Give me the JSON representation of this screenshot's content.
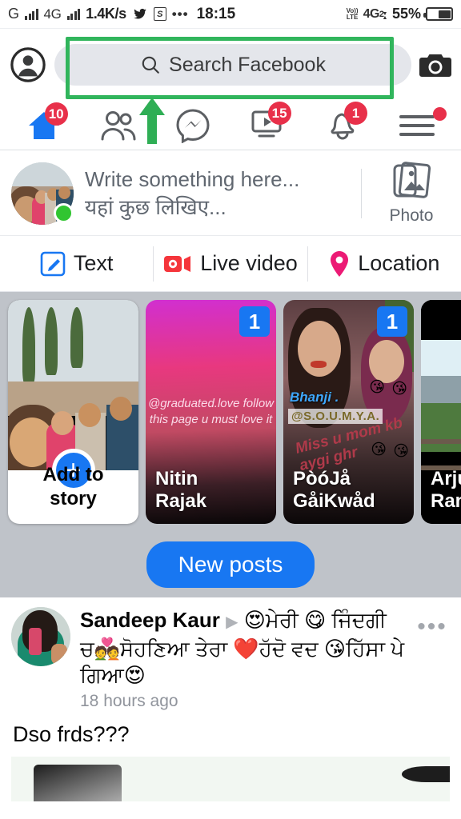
{
  "status_bar": {
    "network_letter": "G",
    "network_type": "4G",
    "data_speed": "1.4K/s",
    "app_icons": [
      "twitter-icon",
      "s-app-icon",
      "more-dots-icon"
    ],
    "time": "18:15",
    "volte_label_top": "Vo))",
    "volte_label_bottom": "LTE",
    "sim_label": "4G",
    "sim_number": "2",
    "battery_percent": "55%"
  },
  "top_bar": {
    "profile_icon": "profile-avatar-icon",
    "search_placeholder": "Search Facebook",
    "search_icon": "search-icon",
    "camera_icon": "camera-icon"
  },
  "highlight": {
    "border_color": "#31b55c",
    "arrow_color": "#2fae55",
    "target": "search-bar"
  },
  "nav_tabs": [
    {
      "name": "home",
      "icon": "home-icon",
      "active": true,
      "badge": "10",
      "color": "#1877f2"
    },
    {
      "name": "friends",
      "icon": "friends-icon",
      "active": false,
      "badge": "",
      "color": "#5c5f63"
    },
    {
      "name": "messenger",
      "icon": "messenger-icon",
      "active": false,
      "badge": "",
      "color": "#5c5f63"
    },
    {
      "name": "watch",
      "icon": "video-play-icon",
      "active": false,
      "badge": "15",
      "color": "#5c5f63"
    },
    {
      "name": "notifications",
      "icon": "bell-icon",
      "active": false,
      "badge": "1",
      "color": "#5c5f63"
    },
    {
      "name": "menu",
      "icon": "hamburger-menu-icon",
      "active": false,
      "badge": "dot",
      "color": "#5c5f63"
    }
  ],
  "composer": {
    "avatar": "user-avatar",
    "online": true,
    "placeholder_line1": "Write something here...",
    "placeholder_line2": "यहां कुछ लिखिए...",
    "photo_label": "Photo",
    "photo_icon": "photo-stack-icon"
  },
  "actions": [
    {
      "label": "Text",
      "icon": "text-compose-icon",
      "color": "#1877f2"
    },
    {
      "label": "Live video",
      "icon": "live-video-icon",
      "color": "#f5353b"
    },
    {
      "label": "Location",
      "icon": "location-pin-icon",
      "color": "#ec1a75"
    }
  ],
  "stories": {
    "add_story": {
      "label_line1": "Add to",
      "label_line2": "story",
      "plus_icon": "plus-icon"
    },
    "items": [
      {
        "name_line1": "Nitin",
        "name_line2": "Rajak",
        "count": "1",
        "overlay_text": "@graduated.love\nfollow this page u must\nlove it"
      },
      {
        "name_line1": "PòóJå",
        "name_line2": "GåiKwåd",
        "count": "1",
        "tag": "Bhanji .",
        "handle": "@S.O.U.M.Y.A.",
        "scribble": "Miss u mom kb aygi ghr"
      },
      {
        "name_line1": "Arjun",
        "name_line2": "Rana",
        "count": "",
        "overlay_text": ""
      }
    ]
  },
  "feed": {
    "new_posts_label": "New posts",
    "post": {
      "author": "Sandeep Kaur",
      "caret_icon": "caret-right-icon",
      "headline_rest": "😍ਮੇਰੀ 😋 ਜਿੰਦਗੀ ਚ💑ਸੋਹਣਿਆ ਤੇਰਾ ❤️ਹੱਦੋ ਵਦ 😘ਹਿੱਸਾ ਪੇ ਗਿਆ😍",
      "timestamp": "18 hours ago",
      "menu_icon": "more-options-icon",
      "body": "Dso frds???"
    }
  },
  "colors": {
    "facebook_blue": "#1877f2",
    "badge_red": "#e8304a",
    "feed_gray": "#bfc3c9",
    "search_gray": "#e4e6eb",
    "text_secondary": "#606770"
  }
}
